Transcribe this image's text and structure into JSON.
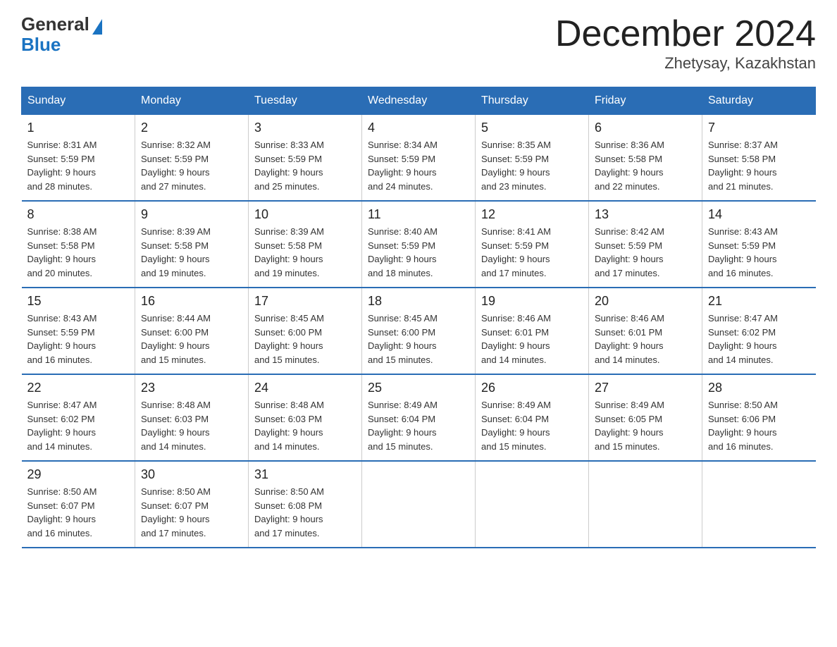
{
  "logo": {
    "general": "General",
    "blue": "Blue"
  },
  "title": "December 2024",
  "location": "Zhetysay, Kazakhstan",
  "headers": [
    "Sunday",
    "Monday",
    "Tuesday",
    "Wednesday",
    "Thursday",
    "Friday",
    "Saturday"
  ],
  "weeks": [
    [
      {
        "day": "1",
        "sunrise": "8:31 AM",
        "sunset": "5:59 PM",
        "daylight": "9 hours and 28 minutes."
      },
      {
        "day": "2",
        "sunrise": "8:32 AM",
        "sunset": "5:59 PM",
        "daylight": "9 hours and 27 minutes."
      },
      {
        "day": "3",
        "sunrise": "8:33 AM",
        "sunset": "5:59 PM",
        "daylight": "9 hours and 25 minutes."
      },
      {
        "day": "4",
        "sunrise": "8:34 AM",
        "sunset": "5:59 PM",
        "daylight": "9 hours and 24 minutes."
      },
      {
        "day": "5",
        "sunrise": "8:35 AM",
        "sunset": "5:59 PM",
        "daylight": "9 hours and 23 minutes."
      },
      {
        "day": "6",
        "sunrise": "8:36 AM",
        "sunset": "5:58 PM",
        "daylight": "9 hours and 22 minutes."
      },
      {
        "day": "7",
        "sunrise": "8:37 AM",
        "sunset": "5:58 PM",
        "daylight": "9 hours and 21 minutes."
      }
    ],
    [
      {
        "day": "8",
        "sunrise": "8:38 AM",
        "sunset": "5:58 PM",
        "daylight": "9 hours and 20 minutes."
      },
      {
        "day": "9",
        "sunrise": "8:39 AM",
        "sunset": "5:58 PM",
        "daylight": "9 hours and 19 minutes."
      },
      {
        "day": "10",
        "sunrise": "8:39 AM",
        "sunset": "5:58 PM",
        "daylight": "9 hours and 19 minutes."
      },
      {
        "day": "11",
        "sunrise": "8:40 AM",
        "sunset": "5:59 PM",
        "daylight": "9 hours and 18 minutes."
      },
      {
        "day": "12",
        "sunrise": "8:41 AM",
        "sunset": "5:59 PM",
        "daylight": "9 hours and 17 minutes."
      },
      {
        "day": "13",
        "sunrise": "8:42 AM",
        "sunset": "5:59 PM",
        "daylight": "9 hours and 17 minutes."
      },
      {
        "day": "14",
        "sunrise": "8:43 AM",
        "sunset": "5:59 PM",
        "daylight": "9 hours and 16 minutes."
      }
    ],
    [
      {
        "day": "15",
        "sunrise": "8:43 AM",
        "sunset": "5:59 PM",
        "daylight": "9 hours and 16 minutes."
      },
      {
        "day": "16",
        "sunrise": "8:44 AM",
        "sunset": "6:00 PM",
        "daylight": "9 hours and 15 minutes."
      },
      {
        "day": "17",
        "sunrise": "8:45 AM",
        "sunset": "6:00 PM",
        "daylight": "9 hours and 15 minutes."
      },
      {
        "day": "18",
        "sunrise": "8:45 AM",
        "sunset": "6:00 PM",
        "daylight": "9 hours and 15 minutes."
      },
      {
        "day": "19",
        "sunrise": "8:46 AM",
        "sunset": "6:01 PM",
        "daylight": "9 hours and 14 minutes."
      },
      {
        "day": "20",
        "sunrise": "8:46 AM",
        "sunset": "6:01 PM",
        "daylight": "9 hours and 14 minutes."
      },
      {
        "day": "21",
        "sunrise": "8:47 AM",
        "sunset": "6:02 PM",
        "daylight": "9 hours and 14 minutes."
      }
    ],
    [
      {
        "day": "22",
        "sunrise": "8:47 AM",
        "sunset": "6:02 PM",
        "daylight": "9 hours and 14 minutes."
      },
      {
        "day": "23",
        "sunrise": "8:48 AM",
        "sunset": "6:03 PM",
        "daylight": "9 hours and 14 minutes."
      },
      {
        "day": "24",
        "sunrise": "8:48 AM",
        "sunset": "6:03 PM",
        "daylight": "9 hours and 14 minutes."
      },
      {
        "day": "25",
        "sunrise": "8:49 AM",
        "sunset": "6:04 PM",
        "daylight": "9 hours and 15 minutes."
      },
      {
        "day": "26",
        "sunrise": "8:49 AM",
        "sunset": "6:04 PM",
        "daylight": "9 hours and 15 minutes."
      },
      {
        "day": "27",
        "sunrise": "8:49 AM",
        "sunset": "6:05 PM",
        "daylight": "9 hours and 15 minutes."
      },
      {
        "day": "28",
        "sunrise": "8:50 AM",
        "sunset": "6:06 PM",
        "daylight": "9 hours and 16 minutes."
      }
    ],
    [
      {
        "day": "29",
        "sunrise": "8:50 AM",
        "sunset": "6:07 PM",
        "daylight": "9 hours and 16 minutes."
      },
      {
        "day": "30",
        "sunrise": "8:50 AM",
        "sunset": "6:07 PM",
        "daylight": "9 hours and 17 minutes."
      },
      {
        "day": "31",
        "sunrise": "8:50 AM",
        "sunset": "6:08 PM",
        "daylight": "9 hours and 17 minutes."
      },
      null,
      null,
      null,
      null
    ]
  ],
  "labels": {
    "sunrise": "Sunrise:",
    "sunset": "Sunset:",
    "daylight": "Daylight:"
  }
}
